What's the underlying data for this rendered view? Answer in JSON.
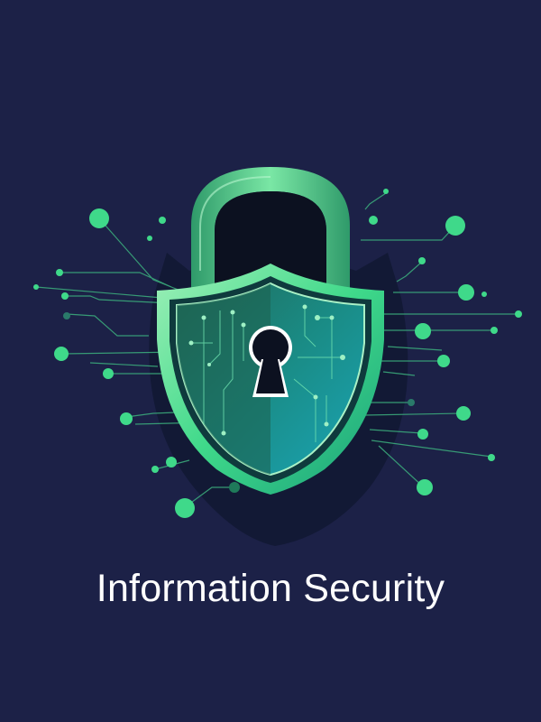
{
  "title": "Information Security",
  "colors": {
    "background": "#1c2147",
    "accent_green": "#3fd98a",
    "accent_teal": "#17a8b0",
    "shield_dark": "#0f3a3d",
    "lock_black": "#0c1120",
    "shackle_green": "#4ecb84",
    "text": "#ffffff"
  },
  "icons": [
    "padlock-icon",
    "shield-icon",
    "keyhole-icon",
    "circuit-network-icon"
  ]
}
